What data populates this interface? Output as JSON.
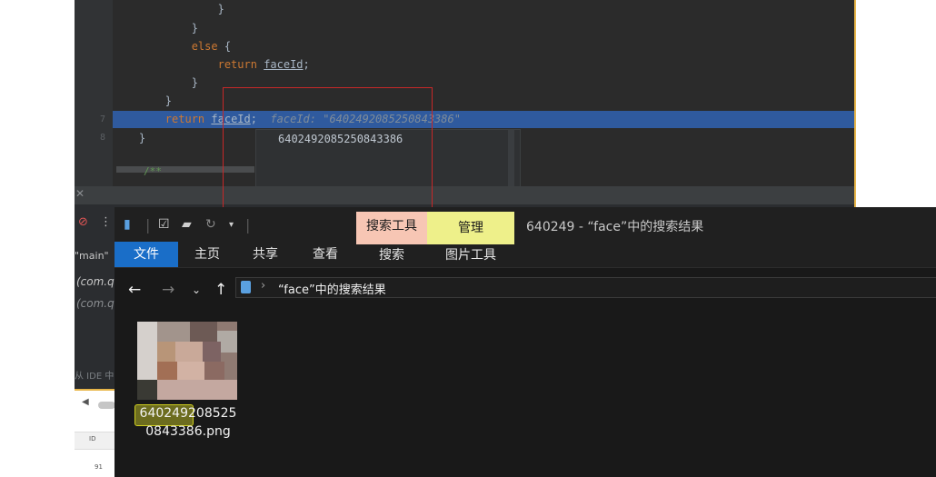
{
  "ide": {
    "code_lines": [
      {
        "indent": "                ",
        "text": "}"
      },
      {
        "indent": "            ",
        "text": "}"
      },
      {
        "indent": "            ",
        "keyword": "else",
        "rest": " {"
      },
      {
        "indent": "                ",
        "keyword": "return",
        "ident": "faceId",
        "rest": ";"
      },
      {
        "indent": "            ",
        "text": "}"
      },
      {
        "indent": "        ",
        "text": "}"
      },
      {
        "indent": "        ",
        "keyword": "return",
        "ident": "faceId",
        "rest": ";",
        "hint": "faceId: \"6402492085250843386\"",
        "highlighted": true
      },
      {
        "indent": "    ",
        "text": "}"
      }
    ],
    "line_numbers": [
      "",
      "",
      "",
      "",
      "",
      "",
      "7",
      "8",
      "",
      ""
    ],
    "doc_comment": "/**",
    "popup_value": "6402492085250843386",
    "frames_label": "\"main\"",
    "frame_1": "(com.q",
    "frame_2": "(com.q",
    "hint_text": "从 IDE 中"
  },
  "outer": {
    "table_col": "ID",
    "row_value": "91"
  },
  "explorer": {
    "context_search_tools": "搜索工具",
    "context_manage": "管理",
    "window_title": "640249 - “face”中的搜索结果",
    "tabs": [
      "文件",
      "主页",
      "共享",
      "查看",
      "搜索",
      "图片工具"
    ],
    "active_tab": "文件",
    "address_path": "“face”中的搜索结果",
    "file": {
      "name_highlight": "640249",
      "name_rest_line1": "208525",
      "name_line2": "0843386.png"
    }
  },
  "colors": {
    "accent": "#1a6ec8",
    "search_tools_tab": "#f7c6b4",
    "manage_tab": "#eef08a",
    "debug_highlight": "#2f5a9e",
    "ide_border": "#e8b64a"
  }
}
